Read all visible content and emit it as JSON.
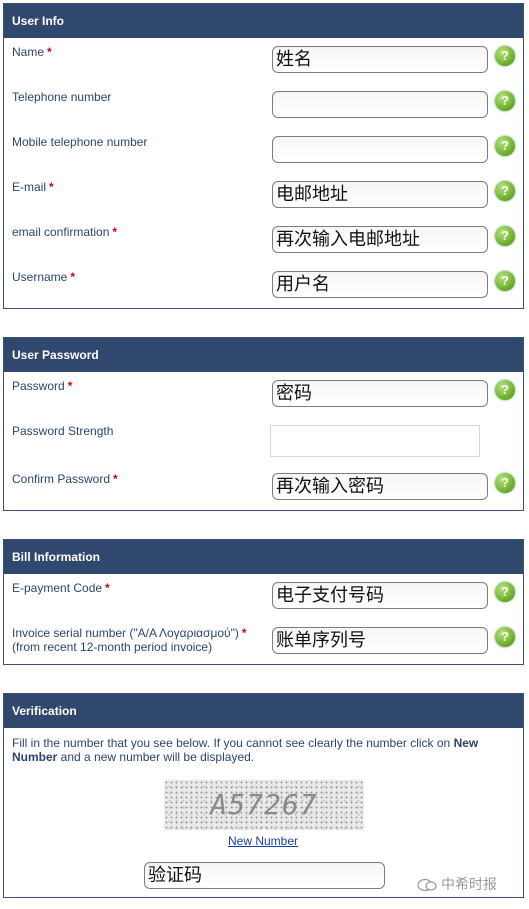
{
  "sections": {
    "user_info": {
      "title": "User Info",
      "fields": [
        {
          "label": "Name",
          "required": "*",
          "value": "姓名"
        },
        {
          "label": "Telephone number",
          "required": "",
          "value": ""
        },
        {
          "label": "Mobile telephone number",
          "required": "",
          "value": ""
        },
        {
          "label": "E-mail",
          "required": "*",
          "value": "电邮地址"
        },
        {
          "label": "email confirmation",
          "required": "*",
          "value": "再次输入电邮地址"
        },
        {
          "label": "Username",
          "required": "*",
          "value": "用户名"
        }
      ]
    },
    "user_password": {
      "title": "User Password",
      "password": {
        "label": "Password",
        "required": "*",
        "value": "密码"
      },
      "strength": {
        "label": "Password Strength"
      },
      "confirm": {
        "label": "Confirm Password",
        "required": "*",
        "value": "再次输入密码"
      }
    },
    "bill_information": {
      "title": "Bill Information",
      "epayment": {
        "label": "E-payment Code",
        "required": "*",
        "value": "电子支付号码"
      },
      "invoice": {
        "label": "Invoice serial number (\"Α/Α Λογαριασμού\")",
        "required": "*",
        "label_line2": "(from recent 12-month period invoice)",
        "value": "账单序列号"
      }
    },
    "verification": {
      "title": "Verification",
      "instruction_part1": "Fill in the number that you see below. If you cannot see clearly the number click on ",
      "instruction_bold1": "New",
      "instruction_bold2": "Number",
      "instruction_part2": " and a new number will be displayed.",
      "captcha_text": "A57267",
      "new_number_link": "New Number",
      "input_value": "验证码"
    }
  },
  "help_symbol": "?",
  "watermark": "中希时报",
  "colors": {
    "header_bg": "#31486e",
    "required": "#d0021b",
    "help_green": "#6fad2c",
    "link": "#1a3ea0"
  }
}
